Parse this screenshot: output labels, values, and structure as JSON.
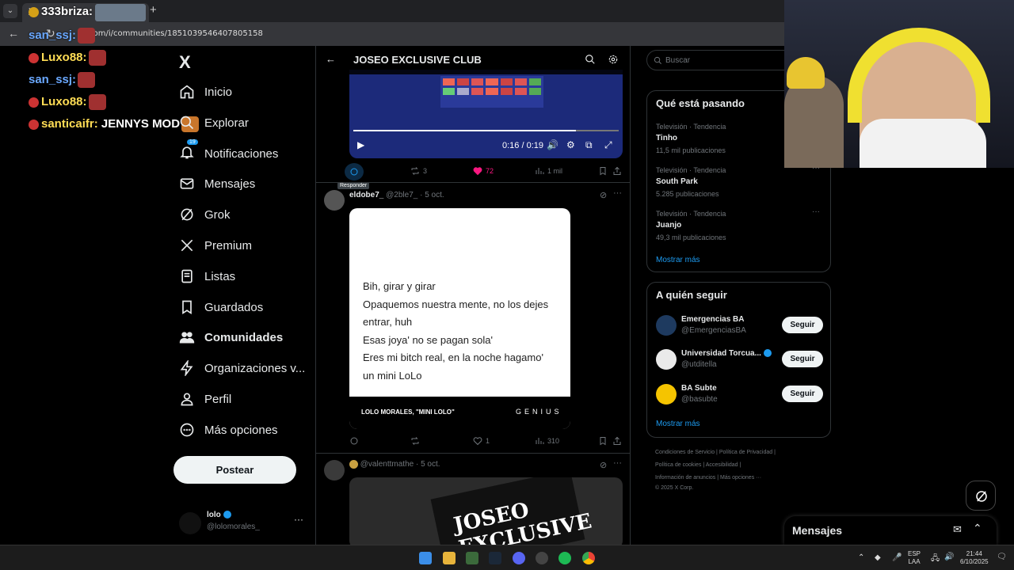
{
  "browser": {
    "tab_label": "X",
    "url": "x.com/i/communities/1851039546407805158"
  },
  "stream_chat": [
    {
      "user": "333briza",
      "text": ""
    },
    {
      "user": "san_ssj",
      "text": ""
    },
    {
      "user": "Luxo88",
      "text": ""
    },
    {
      "user": "san_ssj",
      "text": ""
    },
    {
      "user": "Luxo88",
      "text": ""
    },
    {
      "user": "santicaifr",
      "text": "JENNYS MOD"
    }
  ],
  "leftnav": {
    "logo": "X",
    "items": [
      {
        "label": "Inicio",
        "icon": "home-icon"
      },
      {
        "label": "Explorar",
        "icon": "search-icon"
      },
      {
        "label": "Notificaciones",
        "icon": "bell-icon",
        "badge": "19"
      },
      {
        "label": "Mensajes",
        "icon": "mail-icon"
      },
      {
        "label": "Grok",
        "icon": "grok-icon"
      },
      {
        "label": "Premium",
        "icon": "x-icon"
      },
      {
        "label": "Listas",
        "icon": "list-icon"
      },
      {
        "label": "Guardados",
        "icon": "bookmark-icon"
      },
      {
        "label": "Comunidades",
        "icon": "communities-icon"
      },
      {
        "label": "Organizaciones v...",
        "icon": "bolt-icon"
      },
      {
        "label": "Perfil",
        "icon": "person-icon"
      },
      {
        "label": "Más opciones",
        "icon": "more-circle-icon"
      }
    ],
    "post_button": "Postear",
    "account": {
      "name": "lolo",
      "handle": "@lolomorales_"
    }
  },
  "center": {
    "community_title": "JOSEO EXCLUSIVE CLUB",
    "video": {
      "time": "0:16 / 0:19",
      "progress": 0.84
    },
    "tweet1_actions": {
      "reply_tooltip": "Responder",
      "retweets": "3",
      "likes": "72",
      "views": "1 mil"
    },
    "tweet2": {
      "name": "eldobe7_",
      "handle": "@2ble7_",
      "date": "· 5 oct.",
      "lyrics": [
        "Bih, girar y girar",
        "Opaquemos nuestra mente, no los dejes",
        "entrar, huh",
        "Esas joya' no se pagan sola'",
        "Eres mi bitch real, en la noche hagamo'",
        "un mini LoLo"
      ],
      "card_caption": "LOLO MORALES, \"MINI LOLO\"",
      "card_brand": "GENIUS",
      "likes": "1",
      "views": "310"
    },
    "tweet3": {
      "handle": "@valenttmathe",
      "date": "· 5 oct.",
      "image_text": "JOSEO EXCLUSIVE"
    }
  },
  "right": {
    "search_placeholder": "Buscar",
    "trends_title": "Qué está pasando",
    "trends": [
      {
        "meta": "Televisión · Tendencia",
        "name": "Tinho",
        "count": "11,5 mil publicaciones"
      },
      {
        "meta": "Televisión · Tendencia",
        "name": "South Park",
        "count": "5.285 publicaciones"
      },
      {
        "meta": "Televisión · Tendencia",
        "name": "Juanjo",
        "count": "49,3 mil publicaciones"
      }
    ],
    "show_more": "Mostrar más",
    "follow_title": "A quién seguir",
    "follow": [
      {
        "name": "Emergencias BA",
        "handle": "@EmergenciasBA",
        "button": "Seguir",
        "color": "#1e3a5f"
      },
      {
        "name": "Universidad Torcua...",
        "handle": "@utditella",
        "button": "Seguir",
        "color": "#eaeaea"
      },
      {
        "name": "BA Subte",
        "handle": "@basubte",
        "button": "Seguir",
        "color": "#f5c400"
      }
    ],
    "follow_more": "Mostrar más",
    "footer": [
      [
        "Condiciones de Servicio",
        "Política de Privacidad"
      ],
      [
        "Política de cookies",
        "Accesibilidad"
      ],
      [
        "Información de anuncios",
        "Más opciones ···"
      ],
      [
        "© 2025 X Corp."
      ]
    ]
  },
  "messages_dock": {
    "label": "Mensajes"
  },
  "taskbar": {
    "lang": "ESP",
    "lang2": "LAA",
    "time": "21:44",
    "date": "6/10/2025"
  },
  "colors": {
    "accent": "#1d9bf0",
    "like": "#f91880"
  }
}
